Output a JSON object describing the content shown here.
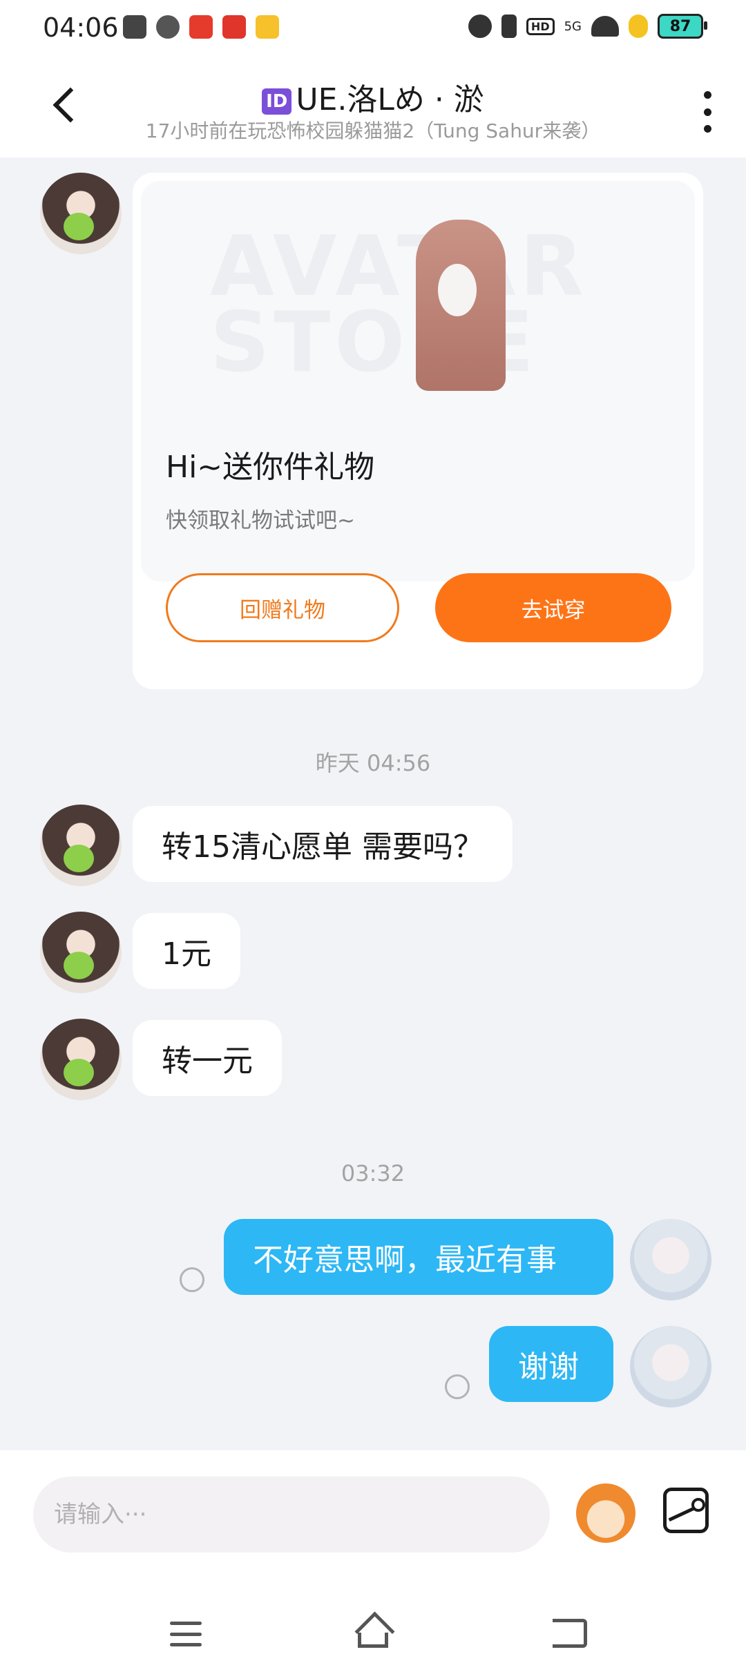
{
  "status_bar": {
    "time": "04:06",
    "network": "5G",
    "hd": "HD",
    "battery": "87",
    "app_icons": [
      "file-box-app",
      "leaf-app",
      "toutiao-app",
      "pinduoduo-app",
      "bird-app"
    ]
  },
  "header": {
    "title": "UE.洛Lめ · 淤",
    "id_badge": "ID",
    "subtitle": "17小时前在玩恐怖校园躲猫猫2（Tung Sahur来袭）"
  },
  "gift_card": {
    "banner_text": "AVATAR STORE",
    "title": "Hi~送你件礼物",
    "subtitle": "快领取礼物试试吧~",
    "return_gift_label": "回赠礼物",
    "try_on_label": "去试穿"
  },
  "messages": {
    "time_1": "昨天 04:56",
    "in_1": "转15清心愿单 需要吗？",
    "in_2": "1元",
    "in_3": "转一元",
    "time_2": "03:32",
    "out_1": "不好意思啊，最近有事",
    "out_2": "谢谢"
  },
  "input": {
    "placeholder": "请输入···"
  },
  "colors": {
    "accent_orange": "#fd7416",
    "bubble_blue": "#2db7f5",
    "background": "#f1f3f7"
  }
}
